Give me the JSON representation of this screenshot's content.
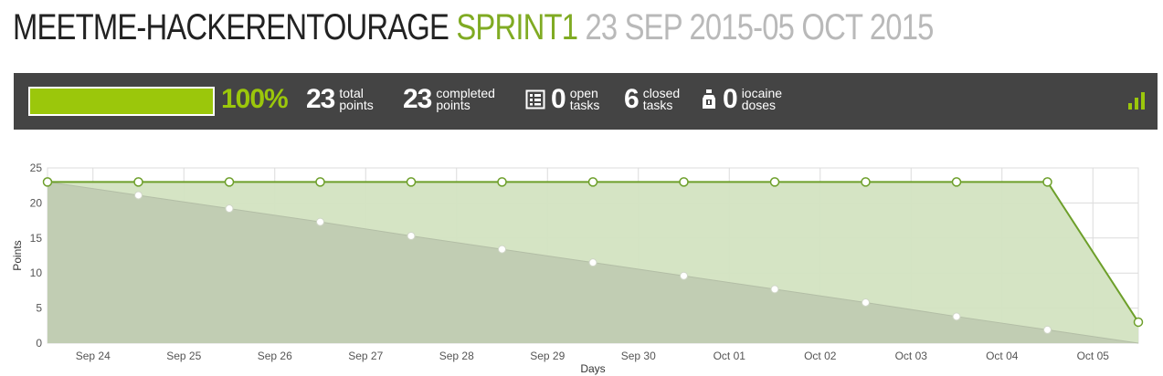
{
  "header": {
    "project": "MEETME-HACKERENTOURAGE",
    "sprint": "SPRINT1",
    "dates": "23 SEP 2015-05 OCT 2015"
  },
  "stats": {
    "progress_percent": 100,
    "progress_label": "100%",
    "total_points": "23",
    "total_points_label": [
      "total",
      "points"
    ],
    "completed_points": "23",
    "completed_points_label": [
      "completed",
      "points"
    ],
    "open_tasks": "0",
    "open_tasks_label": [
      "open",
      "tasks"
    ],
    "closed_tasks": "6",
    "closed_tasks_label": [
      "closed",
      "tasks"
    ],
    "iocaine_doses": "0",
    "iocaine_doses_label": [
      "iocaine",
      "doses"
    ]
  },
  "icons": {
    "open_tasks": "task-list-icon",
    "iocaine": "iocaine-bottle-icon",
    "graph_toggle": "bar-graph-icon"
  },
  "colors": {
    "accent": "#9bc70b",
    "title_green": "#80ab23",
    "actual_line": "#6d9f2a",
    "actual_fill": "#d3e3c1",
    "ideal_fill": "#bfcab1",
    "bar_bg": "#444444"
  },
  "chart_data": {
    "type": "area",
    "xlabel": "Days",
    "ylabel": "Points",
    "ylim": [
      0,
      25
    ],
    "yticks": [
      0,
      5,
      10,
      15,
      20,
      25
    ],
    "xticks": [
      "Sep 24",
      "Sep 25",
      "Sep 26",
      "Sep 27",
      "Sep 28",
      "Sep 29",
      "Sep 30",
      "Oct 01",
      "Oct 02",
      "Oct 03",
      "Oct 04",
      "Oct 05"
    ],
    "grid": true,
    "x": [
      "Sep 23",
      "Sep 24",
      "Sep 25",
      "Sep 26",
      "Sep 27",
      "Sep 28",
      "Sep 29",
      "Sep 30",
      "Oct 01",
      "Oct 02",
      "Oct 03",
      "Oct 04",
      "Oct 05"
    ],
    "series": [
      {
        "values": [
          23,
          23,
          23,
          23,
          23,
          23,
          23,
          23,
          23,
          23,
          23,
          23,
          3
        ]
      },
      {
        "values": [
          23,
          21.1,
          19.2,
          17.3,
          15.3,
          13.4,
          11.5,
          9.6,
          7.7,
          5.8,
          3.8,
          1.9,
          0
        ]
      }
    ]
  }
}
